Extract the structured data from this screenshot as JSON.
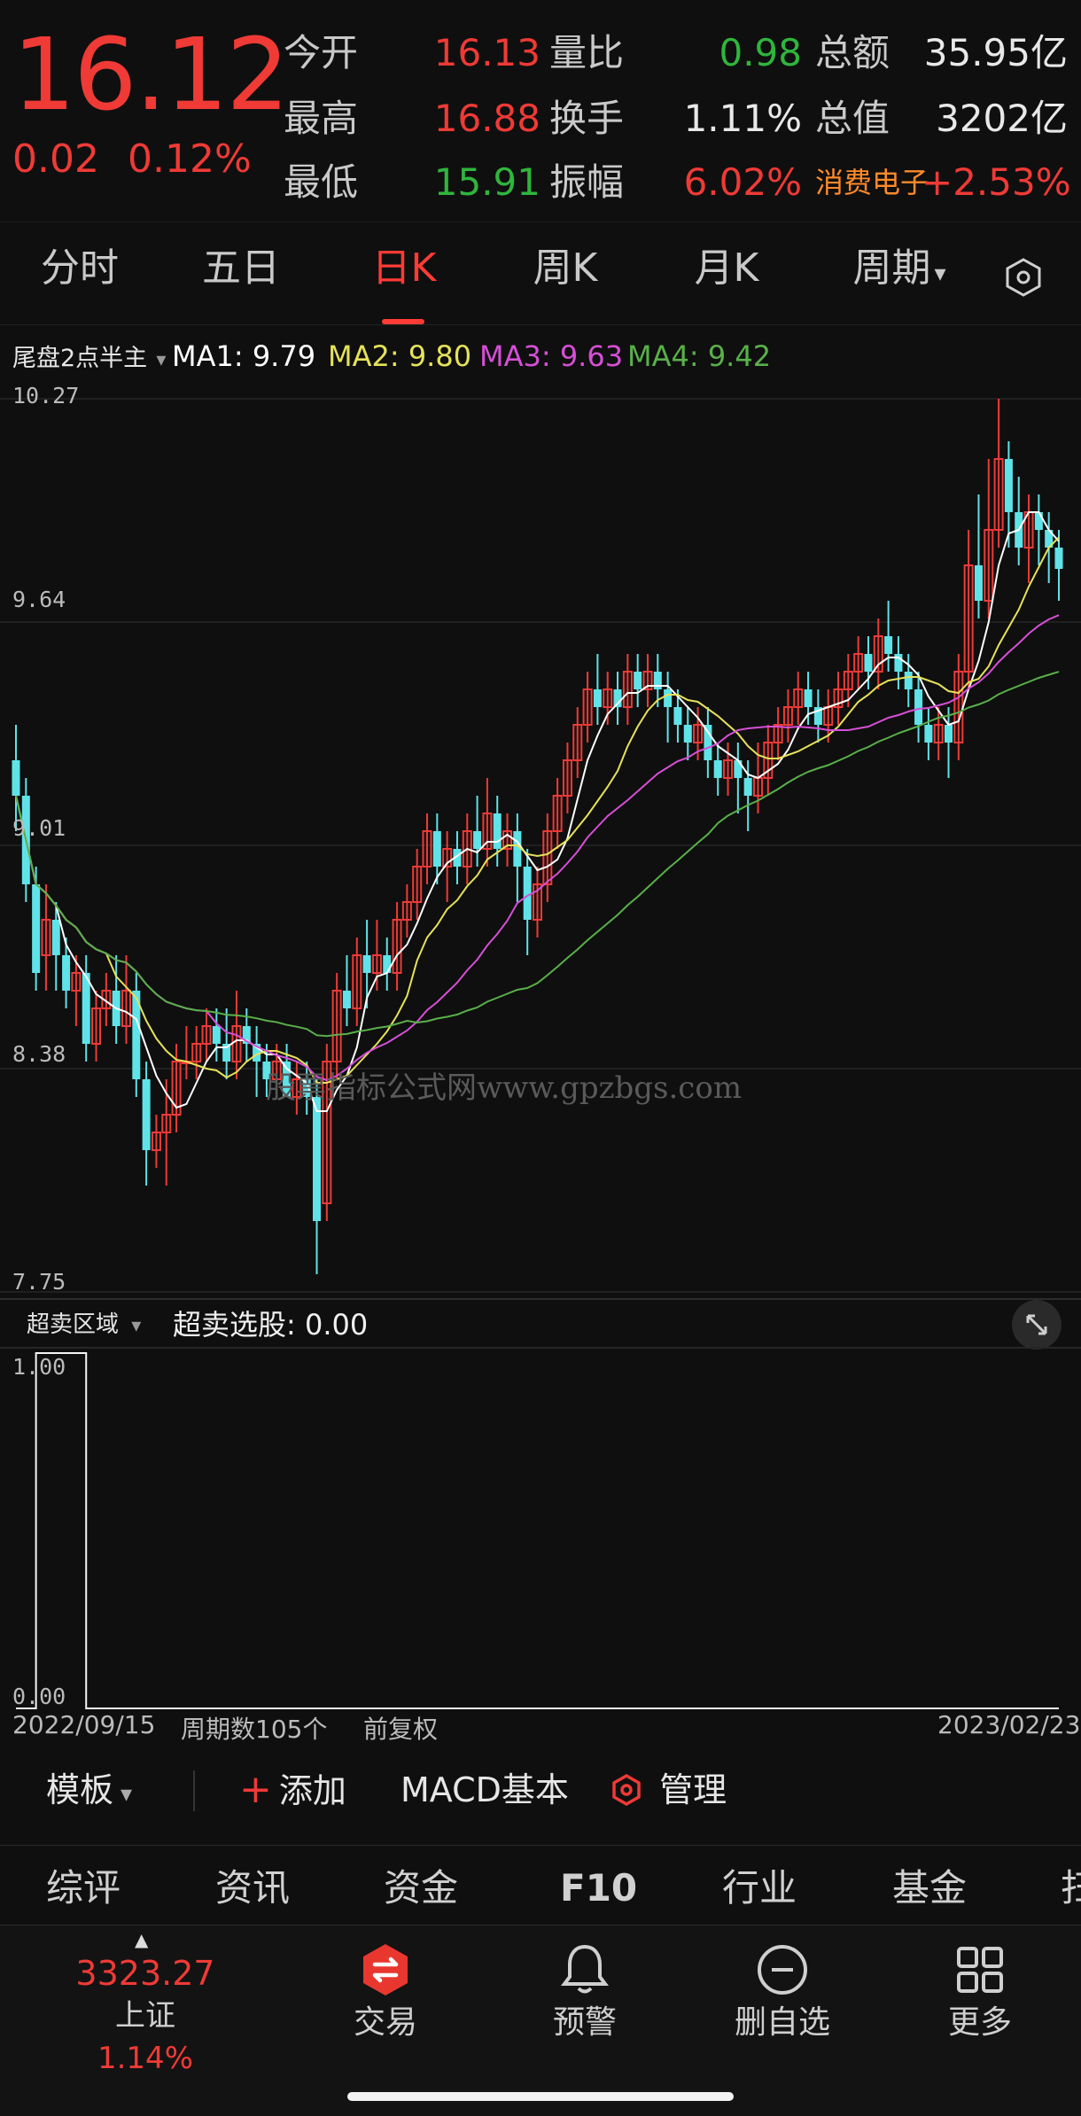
{
  "header": {
    "price": "16.12",
    "change": "0.02",
    "change_pct": "0.12%",
    "rows": [
      {
        "l1": "今开",
        "v1": "16.13",
        "c1": "red",
        "l2": "量比",
        "v2": "0.98",
        "c2": "green",
        "l3": "总额",
        "v3": "35.95亿",
        "c3": "white"
      },
      {
        "l1": "最高",
        "v1": "16.88",
        "c1": "red",
        "l2": "换手",
        "v2": "1.11%",
        "c2": "white",
        "l3": "总值",
        "v3": "3202亿",
        "c3": "white"
      },
      {
        "l1": "最低",
        "v1": "15.91",
        "c1": "green",
        "l2": "振幅",
        "v2": "6.02%",
        "c2": "red",
        "l3": "消费电子",
        "v3": "+2.53%",
        "c3": "red"
      }
    ]
  },
  "tabs": [
    "分时",
    "五日",
    "日K",
    "周K",
    "月K",
    "周期"
  ],
  "active_tab": "日K",
  "indicator_main": {
    "name": "尾盘2点半主",
    "ma1": "MA1: 9.79",
    "ma2": "MA2: 9.80",
    "ma3": "MA3: 9.63",
    "ma4": "MA4: 9.42"
  },
  "colors": {
    "up": "#ef3a36",
    "down": "#5fe3e8",
    "ma1": "#ffffff",
    "ma2": "#e6e25a",
    "ma3": "#d64fd6",
    "ma4": "#59b04a",
    "accent": "#ff3b36"
  },
  "price_axis": [
    "10.27",
    "9.64",
    "9.01",
    "8.38",
    "7.75"
  ],
  "watermark": "股票指标公式网www.gpzbgs.com",
  "indicator_sub": {
    "name": "超卖区域",
    "value_text": "超卖选股: 0.00",
    "axis_top": "1.00",
    "axis_bottom": "0.00"
  },
  "footer_info": {
    "start_date": "2022/09/15",
    "period_count": "周期数105个",
    "adjust": "前复权",
    "end_date": "2023/02/23"
  },
  "toolbar": {
    "template": "模板",
    "add": "添加",
    "macd": "MACD基本",
    "manage": "管理"
  },
  "f_tabs": [
    "综评",
    "资讯",
    "资金",
    "F10",
    "行业",
    "基金",
    "扫"
  ],
  "f_active": "F10",
  "bottom_nav": {
    "index_value": "3323.27",
    "index_name": "上证",
    "index_pct": "1.14%",
    "items": [
      "交易",
      "预警",
      "删自选",
      "更多"
    ]
  },
  "chart_data": {
    "type": "candlestick",
    "ylim": [
      7.75,
      10.27
    ],
    "y_ticks": [
      10.27,
      9.64,
      9.01,
      8.38,
      7.75
    ],
    "x_range": [
      "2022/09/15",
      "2023/02/23"
    ],
    "count": 105,
    "candles": [
      [
        9.25,
        9.15,
        9.35,
        9.05
      ],
      [
        9.15,
        8.9,
        9.2,
        8.85
      ],
      [
        8.9,
        8.65,
        8.95,
        8.6
      ],
      [
        8.7,
        8.8,
        8.9,
        8.6
      ],
      [
        8.8,
        8.7,
        8.85,
        8.6
      ],
      [
        8.7,
        8.6,
        8.75,
        8.55
      ],
      [
        8.6,
        8.65,
        8.7,
        8.5
      ],
      [
        8.65,
        8.45,
        8.7,
        8.4
      ],
      [
        8.45,
        8.55,
        8.6,
        8.4
      ],
      [
        8.55,
        8.6,
        8.65,
        8.5
      ],
      [
        8.6,
        8.5,
        8.7,
        8.45
      ],
      [
        8.5,
        8.6,
        8.7,
        8.45
      ],
      [
        8.6,
        8.35,
        8.65,
        8.3
      ],
      [
        8.35,
        8.15,
        8.4,
        8.05
      ],
      [
        8.15,
        8.2,
        8.25,
        8.1
      ],
      [
        8.2,
        8.25,
        8.35,
        8.05
      ],
      [
        8.25,
        8.4,
        8.45,
        8.2
      ],
      [
        8.4,
        8.4,
        8.5,
        8.35
      ],
      [
        8.4,
        8.45,
        8.5,
        8.35
      ],
      [
        8.45,
        8.5,
        8.55,
        8.4
      ],
      [
        8.5,
        8.45,
        8.55,
        8.4
      ],
      [
        8.45,
        8.4,
        8.55,
        8.35
      ],
      [
        8.4,
        8.5,
        8.6,
        8.35
      ],
      [
        8.5,
        8.45,
        8.55,
        8.4
      ],
      [
        8.45,
        8.4,
        8.5,
        8.3
      ],
      [
        8.4,
        8.35,
        8.45,
        8.3
      ],
      [
        8.35,
        8.4,
        8.45,
        8.3
      ],
      [
        8.4,
        8.3,
        8.45,
        8.3
      ],
      [
        8.3,
        8.35,
        8.4,
        8.25
      ],
      [
        8.35,
        8.3,
        8.4,
        8.25
      ],
      [
        8.3,
        7.95,
        8.35,
        7.8
      ],
      [
        8.0,
        8.4,
        8.45,
        7.95
      ],
      [
        8.4,
        8.6,
        8.65,
        8.35
      ],
      [
        8.6,
        8.55,
        8.7,
        8.5
      ],
      [
        8.55,
        8.7,
        8.75,
        8.5
      ],
      [
        8.7,
        8.65,
        8.8,
        8.55
      ],
      [
        8.65,
        8.7,
        8.8,
        8.6
      ],
      [
        8.7,
        8.65,
        8.75,
        8.6
      ],
      [
        8.65,
        8.8,
        8.85,
        8.6
      ],
      [
        8.8,
        8.85,
        8.9,
        8.75
      ],
      [
        8.85,
        8.95,
        9.0,
        8.8
      ],
      [
        8.95,
        9.05,
        9.1,
        8.9
      ],
      [
        9.05,
        8.95,
        9.1,
        8.9
      ],
      [
        8.95,
        9.0,
        9.05,
        8.85
      ],
      [
        9.0,
        8.95,
        9.05,
        8.9
      ],
      [
        8.95,
        9.05,
        9.1,
        8.9
      ],
      [
        9.05,
        9.0,
        9.15,
        8.95
      ],
      [
        9.0,
        9.1,
        9.2,
        8.95
      ],
      [
        9.1,
        9.0,
        9.15,
        8.95
      ],
      [
        9.0,
        9.05,
        9.1,
        8.95
      ],
      [
        9.05,
        8.95,
        9.1,
        8.85
      ],
      [
        8.95,
        8.8,
        9.0,
        8.7
      ],
      [
        8.8,
        8.9,
        8.95,
        8.75
      ],
      [
        8.9,
        9.05,
        9.1,
        8.85
      ],
      [
        9.05,
        9.15,
        9.2,
        9.0
      ],
      [
        9.15,
        9.25,
        9.3,
        9.1
      ],
      [
        9.25,
        9.35,
        9.4,
        9.2
      ],
      [
        9.35,
        9.45,
        9.5,
        9.3
      ],
      [
        9.45,
        9.4,
        9.55,
        9.35
      ],
      [
        9.4,
        9.45,
        9.5,
        9.35
      ],
      [
        9.45,
        9.4,
        9.5,
        9.35
      ],
      [
        9.4,
        9.5,
        9.55,
        9.35
      ],
      [
        9.5,
        9.45,
        9.55,
        9.4
      ],
      [
        9.45,
        9.5,
        9.55,
        9.4
      ],
      [
        9.5,
        9.45,
        9.55,
        9.4
      ],
      [
        9.45,
        9.4,
        9.5,
        9.3
      ],
      [
        9.4,
        9.35,
        9.45,
        9.3
      ],
      [
        9.35,
        9.3,
        9.4,
        9.25
      ],
      [
        9.3,
        9.35,
        9.4,
        9.25
      ],
      [
        9.35,
        9.25,
        9.4,
        9.2
      ],
      [
        9.25,
        9.2,
        9.3,
        9.15
      ],
      [
        9.2,
        9.25,
        9.3,
        9.15
      ],
      [
        9.25,
        9.2,
        9.3,
        9.1
      ],
      [
        9.2,
        9.15,
        9.25,
        9.05
      ],
      [
        9.15,
        9.2,
        9.3,
        9.1
      ],
      [
        9.2,
        9.3,
        9.35,
        9.15
      ],
      [
        9.3,
        9.35,
        9.4,
        9.25
      ],
      [
        9.35,
        9.4,
        9.45,
        9.3
      ],
      [
        9.4,
        9.45,
        9.5,
        9.35
      ],
      [
        9.45,
        9.4,
        9.5,
        9.35
      ],
      [
        9.4,
        9.35,
        9.45,
        9.3
      ],
      [
        9.35,
        9.4,
        9.45,
        9.3
      ],
      [
        9.4,
        9.45,
        9.5,
        9.35
      ],
      [
        9.45,
        9.5,
        9.55,
        9.4
      ],
      [
        9.5,
        9.55,
        9.6,
        9.45
      ],
      [
        9.55,
        9.5,
        9.6,
        9.45
      ],
      [
        9.5,
        9.6,
        9.65,
        9.45
      ],
      [
        9.6,
        9.55,
        9.7,
        9.5
      ],
      [
        9.55,
        9.5,
        9.6,
        9.45
      ],
      [
        9.5,
        9.45,
        9.55,
        9.4
      ],
      [
        9.45,
        9.35,
        9.5,
        9.3
      ],
      [
        9.35,
        9.3,
        9.4,
        9.25
      ],
      [
        9.3,
        9.35,
        9.4,
        9.25
      ],
      [
        9.35,
        9.3,
        9.4,
        9.2
      ],
      [
        9.3,
        9.5,
        9.55,
        9.25
      ],
      [
        9.5,
        9.8,
        9.9,
        9.45
      ],
      [
        9.8,
        9.7,
        10.0,
        9.65
      ],
      [
        9.7,
        9.9,
        10.1,
        9.65
      ],
      [
        9.9,
        10.1,
        10.27,
        9.85
      ],
      [
        10.1,
        9.95,
        10.15,
        9.85
      ],
      [
        9.95,
        9.85,
        10.05,
        9.8
      ],
      [
        9.85,
        9.95,
        10.0,
        9.75
      ],
      [
        9.95,
        9.9,
        10.0,
        9.8
      ],
      [
        9.9,
        9.85,
        9.95,
        9.75
      ],
      [
        9.85,
        9.79,
        9.9,
        9.7
      ]
    ],
    "ma_series": [
      {
        "name": "MA1",
        "last": 9.79
      },
      {
        "name": "MA2",
        "last": 9.8
      },
      {
        "name": "MA3",
        "last": 9.63
      },
      {
        "name": "MA4",
        "last": 9.42
      }
    ],
    "sub_indicator": {
      "name": "超卖选股",
      "ylim": [
        0,
        1
      ],
      "values_start": [
        0,
        0,
        1,
        1,
        1,
        1,
        1,
        0,
        0,
        0,
        0,
        0,
        0,
        0,
        0,
        0,
        0,
        0,
        0,
        0
      ]
    }
  }
}
